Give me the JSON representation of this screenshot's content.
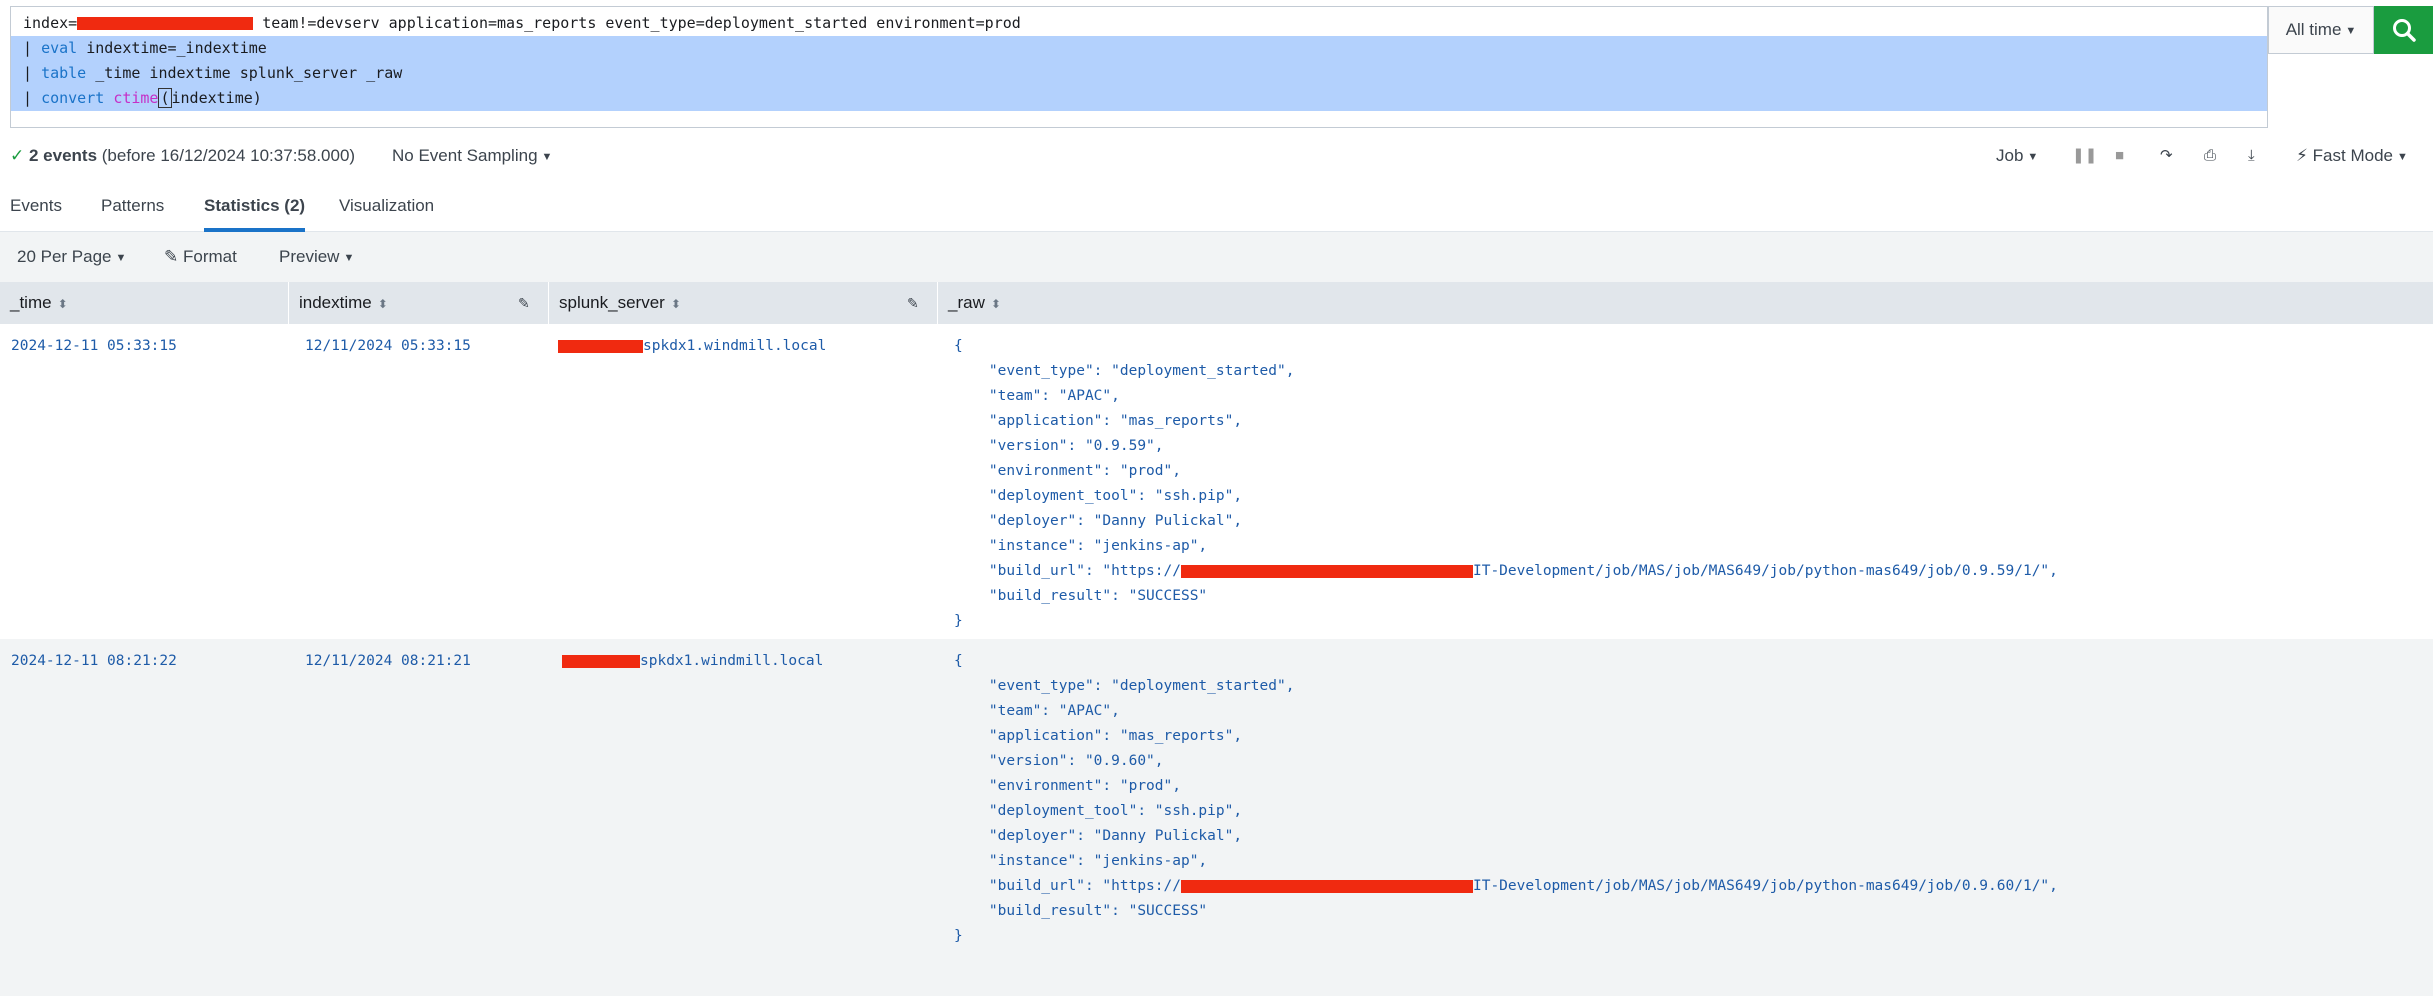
{
  "search": {
    "line1_prefix": "index=",
    "line1_rest": " team!=devserv application=mas_reports event_type=deployment_started environment=prod",
    "line2_kw": "eval",
    "line2_rest": " indextime=_indextime",
    "line3_kw": "table",
    "line3_rest": " _time indextime splunk_server _raw",
    "line4_kw": "convert",
    "line4_fn": "ctime",
    "line4_paren": "(",
    "line4_rest": "indextime)",
    "pipe": "| ",
    "time_range": "All time"
  },
  "status": {
    "events_count": "2 events",
    "events_detail": " (before 16/12/2024 10:37:58.000)",
    "sampling": "No Event Sampling",
    "job": "Job",
    "mode": "Fast Mode"
  },
  "tabs": [
    {
      "label": "Events"
    },
    {
      "label": "Patterns"
    },
    {
      "label": "Statistics (2)"
    },
    {
      "label": "Visualization"
    }
  ],
  "controls": {
    "per_page": "20 Per Page",
    "format": "Format",
    "preview": "Preview"
  },
  "columns": [
    "_time",
    "indextime",
    "splunk_server",
    "_raw"
  ],
  "rows": [
    {
      "time": "2024-12-11 05:33:15",
      "indextime": "12/11/2024 05:33:15",
      "server": "spkdx1.windmill.local",
      "raw": [
        "{",
        "    \"event_type\": \"deployment_started\",",
        "    \"team\": \"APAC\",",
        "    \"application\": \"mas_reports\",",
        "    \"version\": \"0.9.59\",",
        "    \"environment\": \"prod\",",
        "    \"deployment_tool\": \"ssh.pip\",",
        "    \"deployer\": \"Danny Pulickal\",",
        "    \"instance\": \"jenkins-ap\",",
        "    \"build_url\": \"https://",
        "    \"build_result\": \"SUCCESS\"",
        "}"
      ],
      "url_tail": "IT-Development/job/MAS/job/MAS649/job/python-mas649/job/0.9.59/1/\","
    },
    {
      "time": "2024-12-11 08:21:22",
      "indextime": "12/11/2024 08:21:21",
      "server": "spkdx1.windmill.local",
      "raw": [
        "{",
        "    \"event_type\": \"deployment_started\",",
        "    \"team\": \"APAC\",",
        "    \"application\": \"mas_reports\",",
        "    \"version\": \"0.9.60\",",
        "    \"environment\": \"prod\",",
        "    \"deployment_tool\": \"ssh.pip\",",
        "    \"deployer\": \"Danny Pulickal\",",
        "    \"instance\": \"jenkins-ap\",",
        "    \"build_url\": \"https://",
        "    \"build_result\": \"SUCCESS\"",
        "}"
      ],
      "url_tail": "IT-Development/job/MAS/job/MAS649/job/python-mas649/job/0.9.60/1/\","
    }
  ]
}
